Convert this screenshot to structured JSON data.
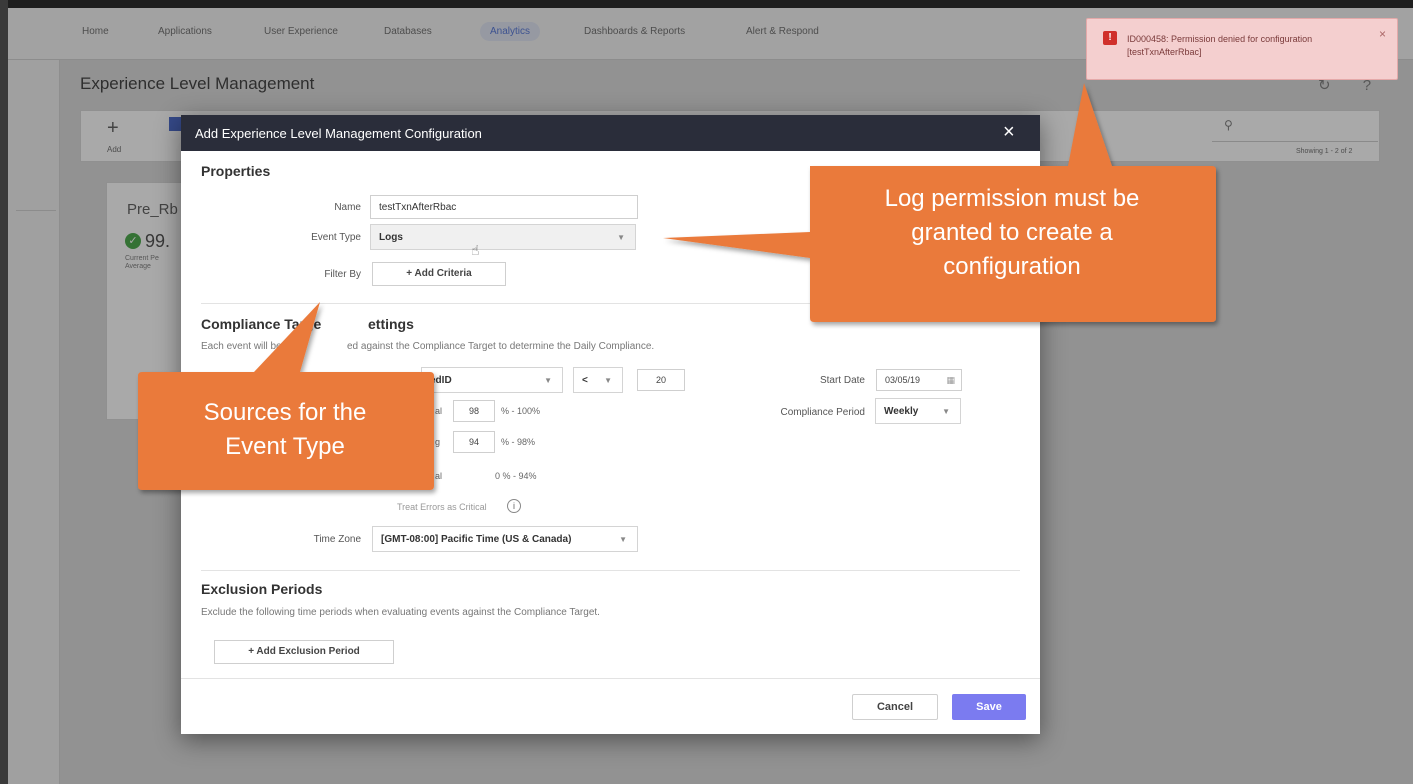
{
  "nav": {
    "items": [
      "Home",
      "Applications",
      "User Experience",
      "Databases",
      "Analytics",
      "Dashboards & Reports",
      "Alert & Respond"
    ],
    "active": "Analytics"
  },
  "page": {
    "title": "Experience Level Management",
    "toolbar_add": "Add",
    "showing": "Showing 1 - 2 of 2"
  },
  "card": {
    "title": "Pre_Rb",
    "value": "99.",
    "sub_line1": "Current Pe",
    "sub_line2": "Average"
  },
  "toast": {
    "icon": "!",
    "text": "ID000458: Permission denied for configuration [testTxnAfterRbac]",
    "close": "×"
  },
  "modal": {
    "title": "Add Experience Level Management Configuration",
    "close": "×",
    "properties": {
      "heading": "Properties",
      "name_label": "Name",
      "name_value": "testTxnAfterRbac",
      "event_type_label": "Event Type",
      "event_type_value": "Logs",
      "filter_by_label": "Filter By",
      "add_criteria": "+ Add Criteria"
    },
    "compliance": {
      "heading_visible_left": "Compliance Targe",
      "heading_visible_right": "ettings",
      "desc_left": "Each event will be e",
      "desc_right": "ed against the Compliance Target to determine the Daily Compliance.",
      "field_value": "edID",
      "operator": "<",
      "threshold": "20",
      "start_date_label": "Start Date",
      "start_date_value": "03/05/19",
      "row1_label": "al",
      "row1_value": "98",
      "row1_range": "% - 100%",
      "row2_label": "g",
      "row2_value": "94",
      "row2_range": "% - 98%",
      "row3_label": "al",
      "row3_range": "0 % - 94%",
      "compliance_period_label": "Compliance Period",
      "compliance_period_value": "Weekly",
      "treat_errors": "Treat Errors as Critical",
      "time_zone_label": "Time Zone",
      "time_zone_value": "[GMT-08:00] Pacific Time (US & Canada)"
    },
    "exclusion": {
      "heading": "Exclusion Periods",
      "desc": "Exclude the following time periods when evaluating events against the Compliance Target.",
      "add_button": "+ Add Exclusion Period"
    },
    "footer": {
      "cancel": "Cancel",
      "save": "Save"
    }
  },
  "callouts": {
    "right_line1": "Log permission must be",
    "right_line2": "granted to create a",
    "right_line3": "configuration",
    "left_line1": "Sources for the",
    "left_line2": "Event Type",
    "color": "#ea7a3a"
  },
  "icons": {
    "add": "plus-icon",
    "search": "search-icon",
    "refresh": "refresh-icon",
    "help": "help-icon",
    "calendar": "calendar-icon",
    "info": "info-icon",
    "check": "check-circle-icon",
    "error": "error-icon",
    "cursor": "hand-cursor-icon"
  }
}
